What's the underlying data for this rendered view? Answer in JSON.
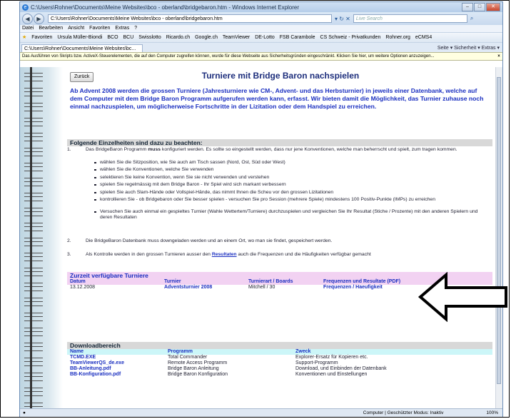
{
  "window": {
    "title": "C:\\Users\\Rohner\\Documents\\Meine Websites\\bco - oberland\\bridgebaron.htm - Windows Internet Explorer",
    "address": "C:\\Users\\Rohner\\Documents\\Meine Websites\\bco - oberland\\bridgebaron.htm",
    "search_placeholder": "Live Search"
  },
  "menu": [
    "Datei",
    "Bearbeiten",
    "Ansicht",
    "Favoriten",
    "Extras",
    "?"
  ],
  "favorites": [
    "Favoriten",
    "Ursula Müller-Biondi",
    "BCO",
    "BCU",
    "Swisslotto",
    "Ricardo.ch",
    "Google.ch",
    "TeamViewer",
    "DE-Lotto",
    "FSB Carambole",
    "CS Schweiz - Privatkunden",
    "Rohner.org",
    "eCMS4"
  ],
  "tab": {
    "label": "C:\\Users\\Rohner\\Documents\\Meine Websites\\bc...",
    "tools": "Seite ▾  Sicherheit ▾  Extras ▾"
  },
  "infobar": "Das Ausführen von Skripts bzw. ActiveX-Steuerelementen, die auf den Computer zugreifen können, wurde für diese Webseite aus Sicherheitsgründen eingeschränkt. Klicken Sie hier, um weitere Optionen anzuzeigen...",
  "page": {
    "back_button": "Zurück",
    "title": "Turniere mit Bridge Baron nachspielen",
    "intro": "Ab Advent 2008 werden die grossen Turniere (Jahresturniere wie CM-, Advent- und das Herbsturnier) in jeweils einer Datenbank, welche auf dem Computer mit dem Bridge Baron Programm aufgerufen werden kann, erfasst. Wir bieten damit die Möglichkeit, das Turnier zuhause noch einmal nachzuspielen, um möglicherweise Fortschritte in der Lizitation oder dem Handspiel zu erreichen.",
    "section_title": "Folgende Einzelheiten sind dazu zu beachten:",
    "item1_num": "1.",
    "item1_a": "Das BridgeBaron Programm ",
    "item1_bold": "muss",
    "item1_b": " konfiguriert werden. Es sollte so eingestellt werden, dass nur jene Konventionen, welche man beherrscht und spielt, zum tragen kommen.",
    "bullets": [
      "wählen Sie die Sitzposition, wie Sie auch am Tisch sassen (Nord, Ost, Süd oder West)",
      "wählen Sie die Konventionen, welche Sie verwenden",
      "selektieren Sie keine Konvention, wenn Sie sie nicht verwenden und verstehen",
      "spielen Sie regelmässig mit dem Bridge Baron - Ihr Spiel wird sich markant verbessern",
      "spielen Sie auch Slam-Hände oder Vollspiel-Hände, das nimmt Ihnen die Scheu vor den grossen Lizitationen",
      "kontrollieren Sie - ob Bridgebaron oder Sie besser spielen - versuchen Sie pro Session (mehrere Spiele) mindestens 100 Positiv-Punkte (IMPs) zu erreichen",
      "Versuchen Sie auch einmal ein gespieltes Turnier (Wahle Wettertem/Turniere) durchzuspielen und vergleichen Sie Ihr Resultat (Stiche / Prozente) mit den anderen Spielern und deren Resultaten"
    ],
    "item2_num": "2.",
    "item2": "Die BridgeBaron Datenbank muss downgeladen werden und an einem Ort, wo man sie findet, gespeichert werden.",
    "item3_num": "3.",
    "item3_a": "Als Kontrolle werden in den grossen Turnieren ausser den ",
    "item3_link": "Resultaten",
    "item3_b": " auch die Frequenzen und die Häufigkeiten verfügbar gemacht",
    "tournaments": {
      "title": "Zurzeit verfügbare Turniere",
      "headers": [
        "Datum",
        "Turnier",
        "Turnierart / Boards",
        "Frequenzen und Resultate (PDF)"
      ],
      "rows": [
        {
          "date": "13.12.2008",
          "name": "Adventsturnier 2008",
          "type": "Mitchell / 30",
          "freq": "Frequenzen",
          "sep": " / ",
          "haeuf": "Haeufigkeit"
        }
      ]
    },
    "downloads": {
      "title": "Downloadbereich",
      "headers": [
        "Name",
        "Programm",
        "Zweck"
      ],
      "rows": [
        {
          "name": "TCMD.EXE",
          "prog": "Total Commander",
          "zweck": "Explorer-Ersatz für Kopieren etc."
        },
        {
          "name": "TeamViewerQS_de.exe",
          "prog": "Remote Access Programm",
          "zweck": "Support-Programm"
        },
        {
          "name": "BB-Anleitung.pdf",
          "prog": "Bridge Baron Anleitung",
          "zweck": "Download, und Einbinden der Datenbank"
        },
        {
          "name": "BB-Konfiguration.pdf",
          "prog": "Bridge Baron Konfiguration",
          "zweck": "Konventionen und Einstellungen"
        }
      ]
    }
  },
  "status": {
    "zone": "Computer | Geschützter Modus: Inaktiv",
    "zoom": "100%"
  },
  "colors": {
    "link": "#1a2fc0",
    "header_pink": "#f2d2f2",
    "header_cyan": "#ccf6f8",
    "section_gray": "#d8d8d8"
  }
}
